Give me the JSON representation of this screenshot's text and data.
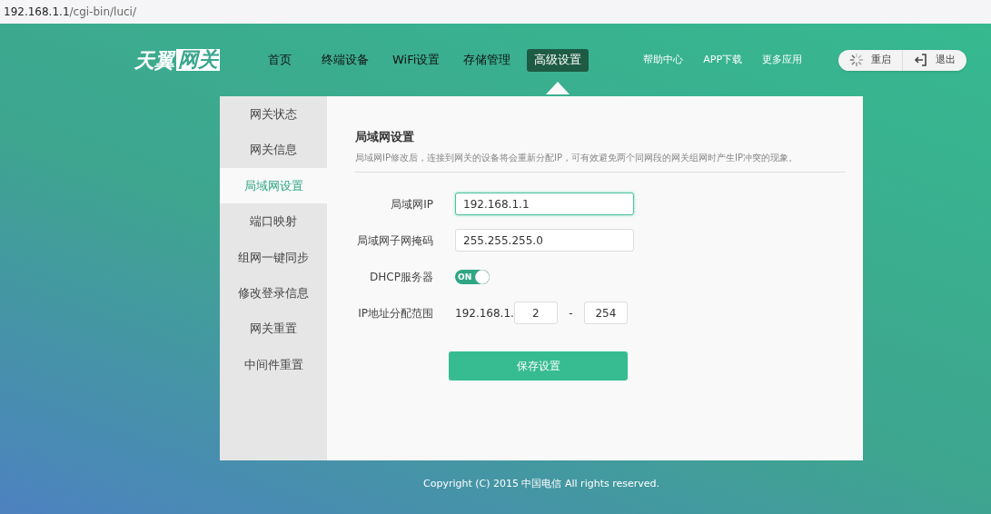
{
  "address_bar": {
    "host": "192.168.1.1",
    "path": "/cgi-bin/luci/"
  },
  "logo": {
    "part_1": "天翼",
    "part_2": "网关"
  },
  "nav": [
    {
      "label": "首页",
      "selected": false
    },
    {
      "label": "终端设备",
      "selected": false
    },
    {
      "label": "WiFi设置",
      "selected": false
    },
    {
      "label": "存储管理",
      "selected": false
    },
    {
      "label": "高级设置",
      "selected": true
    }
  ],
  "links": [
    "帮助中心",
    "APP下载",
    "更多应用"
  ],
  "actions": [
    {
      "kind": "restart",
      "label": "重启"
    },
    {
      "kind": "logout",
      "label": "退出"
    }
  ],
  "sidebar": [
    {
      "label": "网关状态",
      "selected": false
    },
    {
      "label": "网关信息",
      "selected": false
    },
    {
      "label": "局域网设置",
      "selected": true
    },
    {
      "label": "端口映射",
      "selected": false
    },
    {
      "label": "组网一键同步",
      "selected": false
    },
    {
      "label": "修改登录信息",
      "selected": false
    },
    {
      "label": "网关重置",
      "selected": false
    },
    {
      "label": "中间件重置",
      "selected": false
    }
  ],
  "section": {
    "title": "局域网设置",
    "description": "局域网IP修改后，连接到网关的设备将会重新分配IP，可有效避免两个同网段的网关组网时产生IP冲突的现象。"
  },
  "form": [
    {
      "kind": "text",
      "label": "局域网IP",
      "value": "192.168.1.1",
      "focused": true
    },
    {
      "kind": "text",
      "label": "局域网子网掩码",
      "value": "255.255.255.0",
      "focused": false
    },
    {
      "kind": "toggle",
      "label": "DHCP服务器",
      "on": true,
      "text": "ON"
    },
    {
      "kind": "range",
      "label": "IP地址分配范围",
      "prefix": "192.168.1.",
      "start": "2",
      "separator": "-",
      "end": "254"
    }
  ],
  "save_button": "保存设置",
  "footer": "Copyright (C) 2015 中国电信 All rights reserved."
}
